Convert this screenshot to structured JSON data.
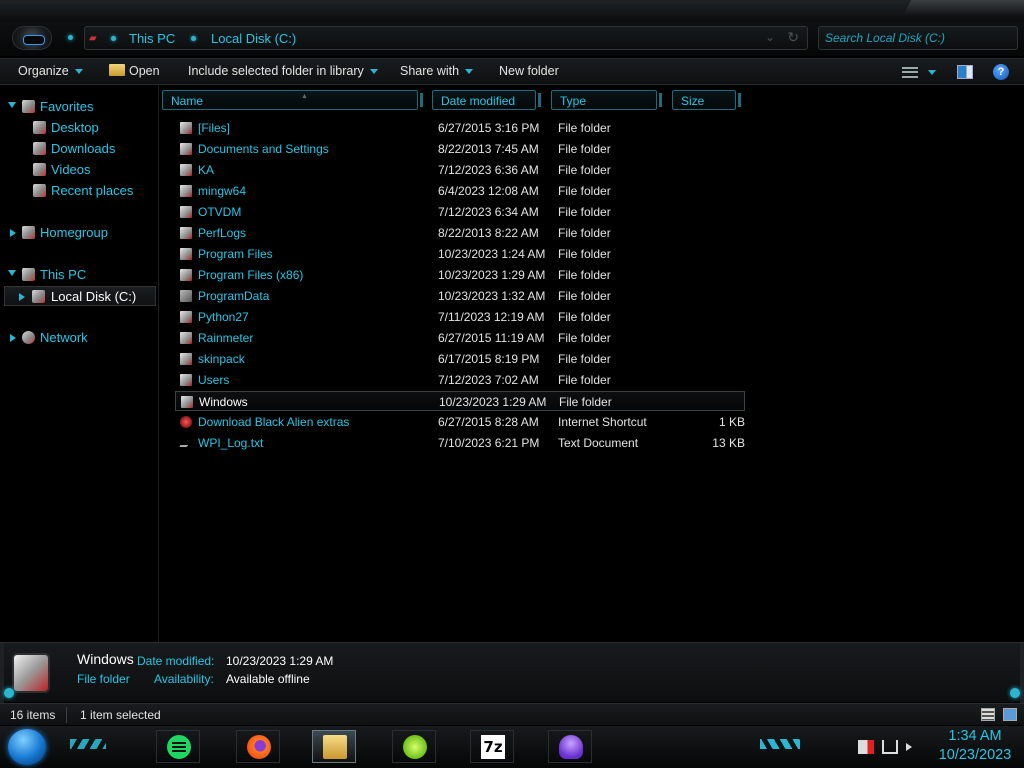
{
  "window": {
    "breadcrumbs": [
      "This PC",
      "Local Disk (C:)"
    ],
    "search_placeholder": "Search Local Disk (C:)"
  },
  "toolbar": {
    "organize": "Organize",
    "open": "Open",
    "include": "Include selected folder in library",
    "share": "Share with",
    "new_folder": "New folder"
  },
  "nav": {
    "favorites": "Favorites",
    "desktop": "Desktop",
    "downloads": "Downloads",
    "videos": "Videos",
    "recent": "Recent places",
    "homegroup": "Homegroup",
    "this_pc": "This PC",
    "local_disk": "Local Disk (C:)",
    "network": "Network"
  },
  "columns": {
    "name": "Name",
    "date": "Date modified",
    "type": "Type",
    "size": "Size"
  },
  "files": [
    {
      "name": "[Files]",
      "date": "6/27/2015 3:16 PM",
      "type": "File folder",
      "size": ""
    },
    {
      "name": "Documents and Settings",
      "date": "8/22/2013 7:45 AM",
      "type": "File folder",
      "size": ""
    },
    {
      "name": "KA",
      "date": "7/12/2023 6:36 AM",
      "type": "File folder",
      "size": ""
    },
    {
      "name": "mingw64",
      "date": "6/4/2023 12:08 AM",
      "type": "File folder",
      "size": ""
    },
    {
      "name": "OTVDM",
      "date": "7/12/2023 6:34 AM",
      "type": "File folder",
      "size": ""
    },
    {
      "name": "PerfLogs",
      "date": "8/22/2013 8:22 AM",
      "type": "File folder",
      "size": ""
    },
    {
      "name": "Program Files",
      "date": "10/23/2023 1:24 AM",
      "type": "File folder",
      "size": ""
    },
    {
      "name": "Program Files (x86)",
      "date": "10/23/2023 1:29 AM",
      "type": "File folder",
      "size": ""
    },
    {
      "name": "ProgramData",
      "date": "10/23/2023 1:32 AM",
      "type": "File folder",
      "size": ""
    },
    {
      "name": "Python27",
      "date": "7/11/2023 12:19 AM",
      "type": "File folder",
      "size": ""
    },
    {
      "name": "Rainmeter",
      "date": "6/27/2015 11:19 AM",
      "type": "File folder",
      "size": ""
    },
    {
      "name": "skinpack",
      "date": "6/17/2015 8:19 PM",
      "type": "File folder",
      "size": ""
    },
    {
      "name": "Users",
      "date": "7/12/2023 7:02 AM",
      "type": "File folder",
      "size": ""
    },
    {
      "name": "Windows",
      "date": "10/23/2023 1:29 AM",
      "type": "File folder",
      "size": ""
    },
    {
      "name": "Download Black Alien extras",
      "date": "6/27/2015 8:28 AM",
      "type": "Internet Shortcut",
      "size": "1 KB"
    },
    {
      "name": "WPI_Log.txt",
      "date": "7/10/2023 6:21 PM",
      "type": "Text Document",
      "size": "13 KB"
    }
  ],
  "details": {
    "name": "Windows",
    "date_label": "Date modified:",
    "date_value": "10/23/2023 1:29 AM",
    "type": "File folder",
    "avail_label": "Availability:",
    "avail_value": "Available offline"
  },
  "status": {
    "count": "16 items",
    "selected": "1 item selected"
  },
  "taskbar": {
    "sevenzip": "7z",
    "time": "1:34 AM",
    "date": "10/23/2023"
  },
  "colors": {
    "accent": "#25c6e6",
    "background": "#000000",
    "text": "#e4e4e4"
  }
}
